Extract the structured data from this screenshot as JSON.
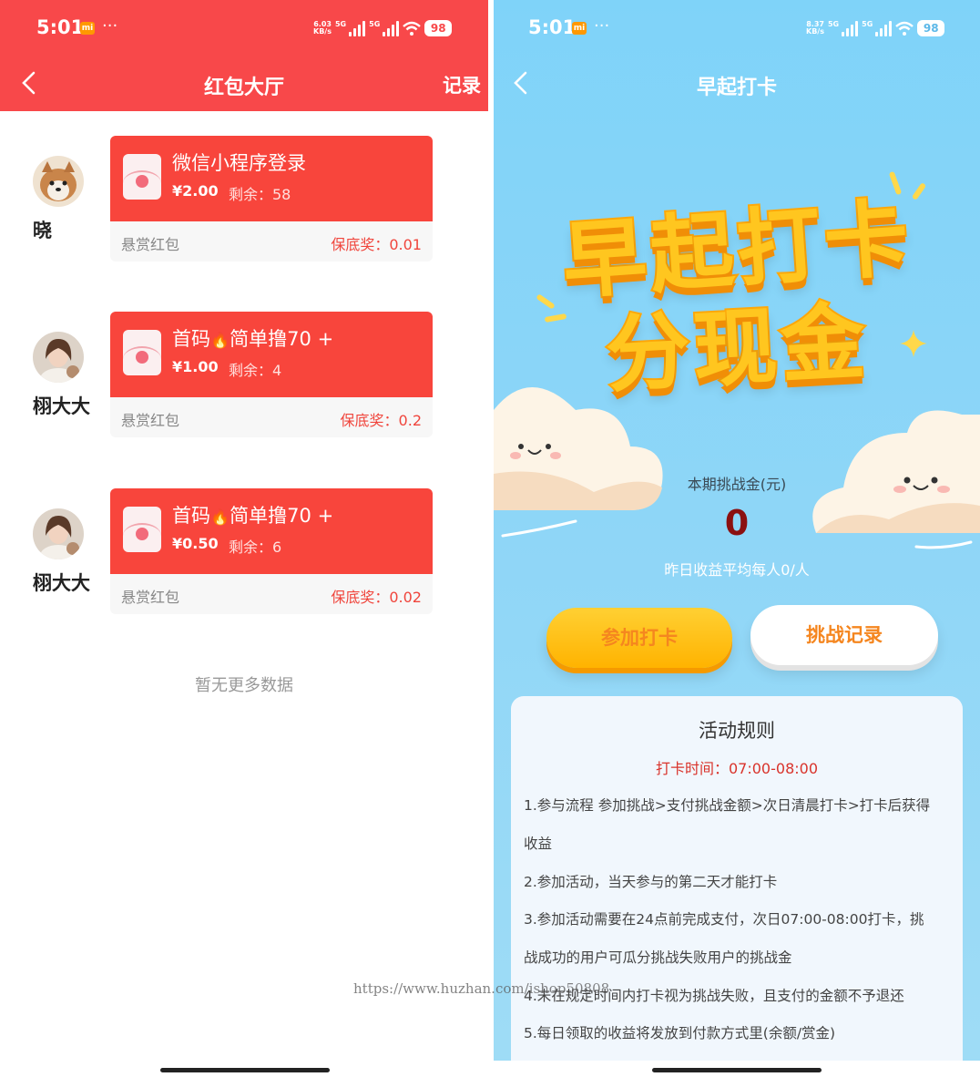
{
  "left": {
    "status": {
      "time": "5:01",
      "network_speed": "6.03\nKB/s",
      "battery": "98"
    },
    "nav": {
      "title": "红包大厅",
      "action": "记录"
    },
    "entries": [
      {
        "user": "晓",
        "title": "微信小程序登录",
        "amount": "¥2.00",
        "remaining": "剩余：58",
        "type": "悬赏红包",
        "min_reward": "保底奖：0.01"
      },
      {
        "user": "栩大大",
        "title_prefix": "首码",
        "title_suffix": "简单撸70 +",
        "amount": "¥1.00",
        "remaining": "剩余：4",
        "type": "悬赏红包",
        "min_reward": "保底奖：0.2"
      },
      {
        "user": "栩大大",
        "title_prefix": "首码",
        "title_suffix": "简单撸70 +",
        "amount": "¥0.50",
        "remaining": "剩余：6",
        "type": "悬赏红包",
        "min_reward": "保底奖：0.02"
      }
    ],
    "no_more": "暂无更多数据"
  },
  "right": {
    "status": {
      "time": "5:01",
      "network_speed": "8.37\nKB/s",
      "battery": "98"
    },
    "nav": {
      "title": "早起打卡"
    },
    "hero": {
      "line1": "早起打卡",
      "line2": "分现金"
    },
    "stake_label": "本期挑战金(元)",
    "stake_value": "0",
    "avg_text": "昨日收益平均每人0/人",
    "buttons": {
      "join": "参加打卡",
      "records": "挑战记录"
    },
    "rules": {
      "title": "活动规则",
      "time": "打卡时间：07:00-08:00",
      "lines": [
        "1.参与流程 参加挑战>支付挑战金额>次日清晨打卡>打卡后获得",
        "收益",
        "2.参加活动，当天参与的第二天才能打卡",
        "3.参加活动需要在24点前完成支付，次日07:00-08:00打卡，挑",
        "战成功的用户可瓜分挑战失败用户的挑战金",
        "4.未在规定时间内打卡视为挑战失败，且支付的金额不予退还",
        "5.每日领取的收益将发放到付款方式里(余额/赏金)"
      ]
    }
  },
  "watermark": "https://www.huzhan.com/ishop50808",
  "colors": {
    "red": "#f8484a",
    "card_red": "#f8453c",
    "sky": "#8fd6f7",
    "gold": "#ffc61f",
    "orange_text": "#f5861f"
  }
}
